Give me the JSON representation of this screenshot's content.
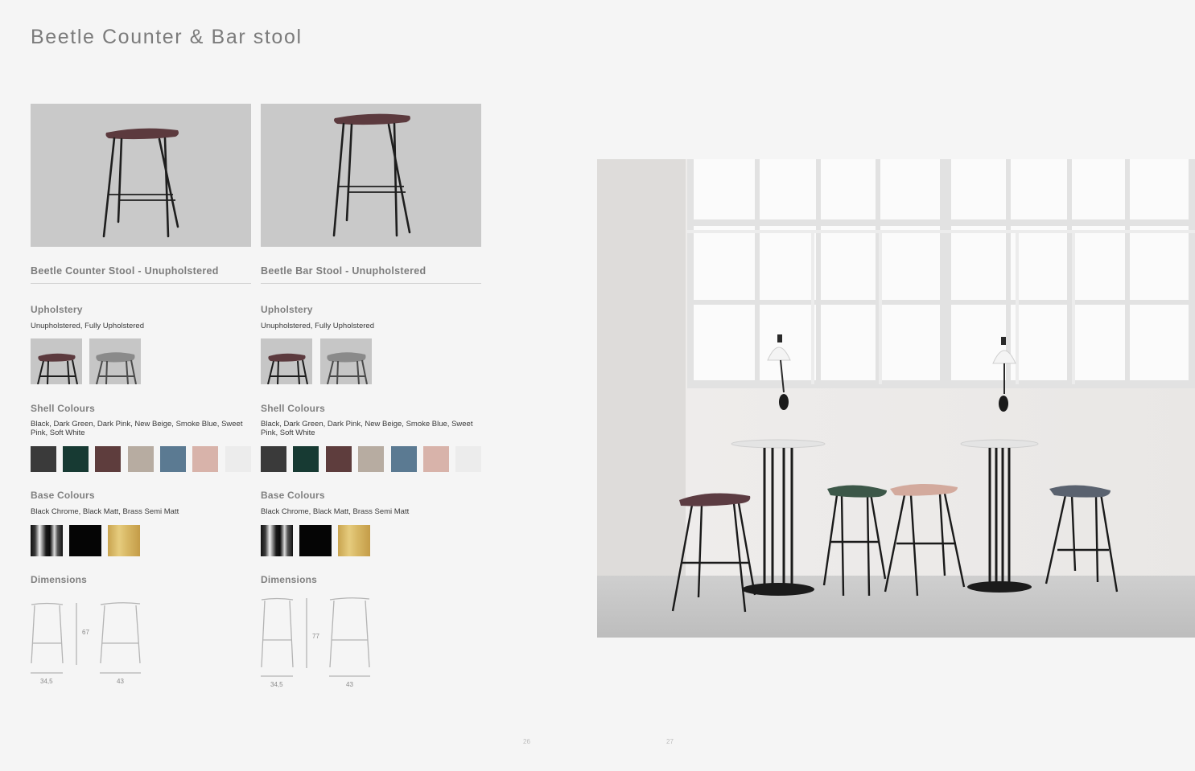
{
  "page": {
    "title": "Beetle Counter & Bar stool"
  },
  "products": [
    {
      "name": "Beetle Counter Stool - Unupholstered",
      "upholstery": {
        "heading": "Upholstery",
        "options": "Unupholstered, Fully Upholstered"
      },
      "shell": {
        "heading": "Shell Colours",
        "options": "Black, Dark Green, Dark Pink, New Beige, Smoke Blue, Sweet Pink, Soft White",
        "swatches": [
          "#3a3a3a",
          "#173a33",
          "#5e3d3d",
          "#b7aca1",
          "#5b7a92",
          "#d8b3aa",
          "#ececec"
        ]
      },
      "base": {
        "heading": "Base Colours",
        "options": "Black Chrome, Black Matt, Brass Semi Matt",
        "swatches": [
          "black-chrome",
          "#050505",
          "brass"
        ]
      },
      "dimensions": {
        "heading": "Dimensions",
        "height": "67",
        "width": "34,5",
        "depth": "43"
      }
    },
    {
      "name": "Beetle Bar Stool - Unupholstered",
      "upholstery": {
        "heading": "Upholstery",
        "options": "Unupholstered, Fully Upholstered"
      },
      "shell": {
        "heading": "Shell Colours",
        "options": "Black, Dark Green, Dark Pink, New Beige, Smoke Blue, Sweet Pink, Soft White",
        "swatches": [
          "#3a3a3a",
          "#173a33",
          "#5e3d3d",
          "#b7aca1",
          "#5b7a92",
          "#d8b3aa",
          "#ececec"
        ]
      },
      "base": {
        "heading": "Base Colours",
        "options": "Black Chrome, Black Matt, Brass Semi Matt",
        "swatches": [
          "black-chrome",
          "#050505",
          "brass"
        ]
      },
      "dimensions": {
        "heading": "Dimensions",
        "height": "77",
        "width": "34,5",
        "depth": "43"
      }
    }
  ],
  "folios": {
    "left": "26",
    "right": "27"
  }
}
